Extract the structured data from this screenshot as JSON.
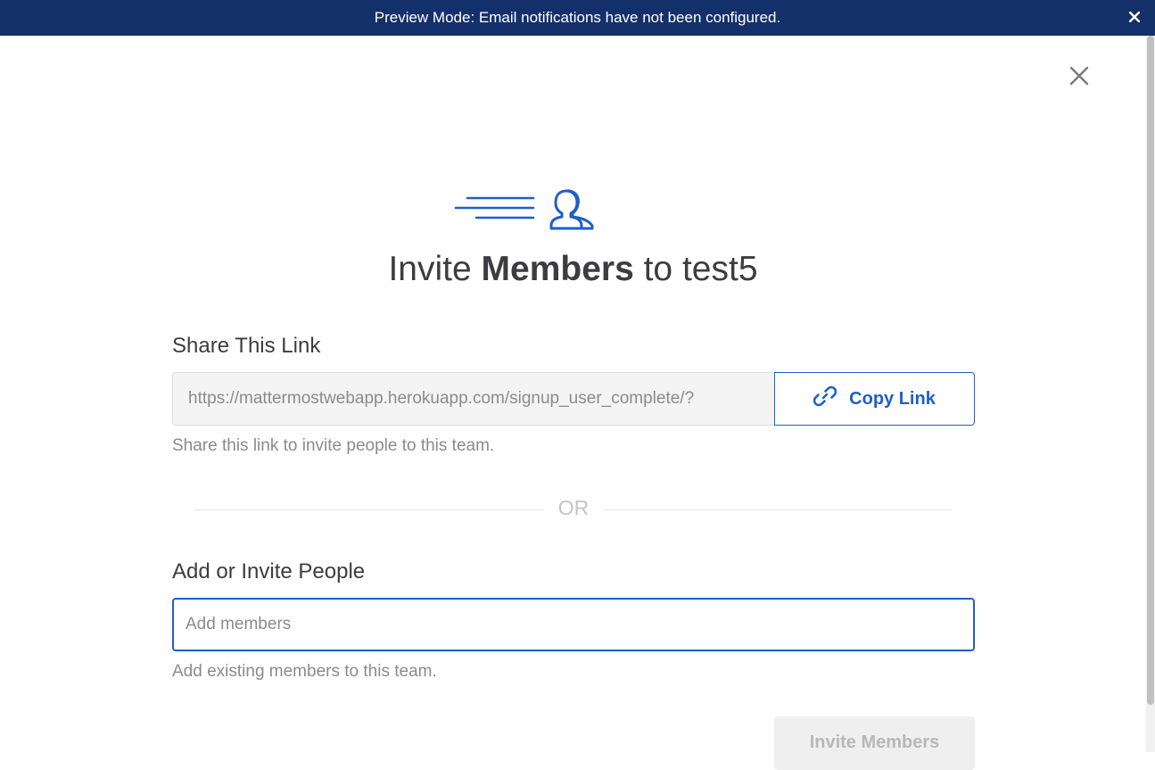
{
  "banner": {
    "text": "Preview Mode: Email notifications have not been configured."
  },
  "modal": {
    "title_prefix": "Invite ",
    "title_bold": "Members",
    "title_suffix": " to test5",
    "share": {
      "label": "Share This Link",
      "link_value": "https://mattermostwebapp.herokuapp.com/signup_user_complete/?",
      "copy_button_label": "Copy Link",
      "helper": "Share this link to invite people to this team."
    },
    "divider_text": "OR",
    "invite": {
      "label": "Add or Invite People",
      "placeholder": "Add members",
      "helper": "Add existing members to this team.",
      "button_label": "Invite Members"
    }
  },
  "colors": {
    "banner_bg": "#14306a",
    "accent": "#1e5fc7"
  },
  "icons": {
    "banner_close": "close-icon",
    "modal_close": "close-icon",
    "hero": "invite-members-icon",
    "copy": "link-icon"
  }
}
